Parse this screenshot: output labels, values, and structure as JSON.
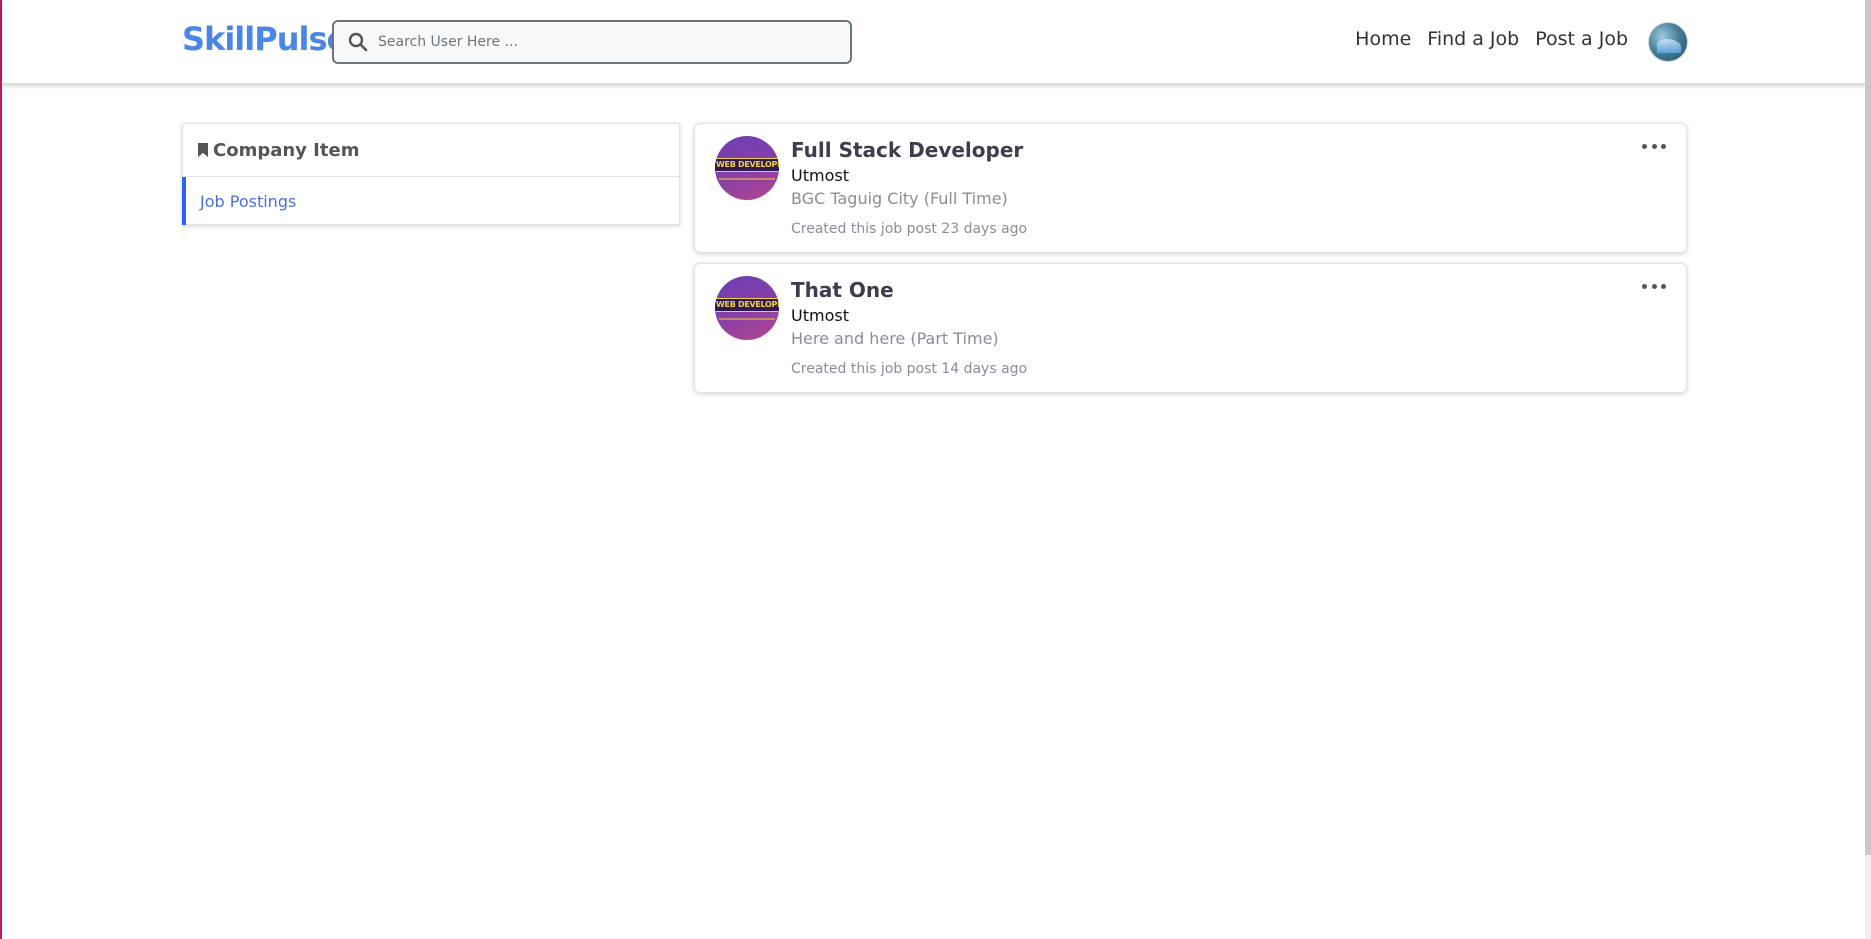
{
  "header": {
    "brand": "SkillPulse",
    "search": {
      "placeholder": "Search User Here ...",
      "value": ""
    },
    "nav": [
      "Home",
      "Find a Job",
      "Post a Job"
    ],
    "avatar_icon": "user-avatar"
  },
  "sidebar": {
    "title": "Company Item",
    "title_icon": "bookmark-icon",
    "items": [
      {
        "label": "Job Postings",
        "active": true
      }
    ]
  },
  "jobs": [
    {
      "title": "Full Stack Developer",
      "company": "Utmost",
      "location": "BGC Taguig City (Full Time)",
      "created": "Created this job post 23 days ago",
      "logo_text": "WEB DEVELOPER"
    },
    {
      "title": "That One",
      "company": "Utmost",
      "location": "Here and here (Part Time)",
      "created": "Created this job post 14 days ago",
      "logo_text": "WEB DEVELOPER"
    }
  ],
  "colors": {
    "brand": "#4a86e8",
    "accent": "#2962ff",
    "muted": "#8c8c99"
  }
}
